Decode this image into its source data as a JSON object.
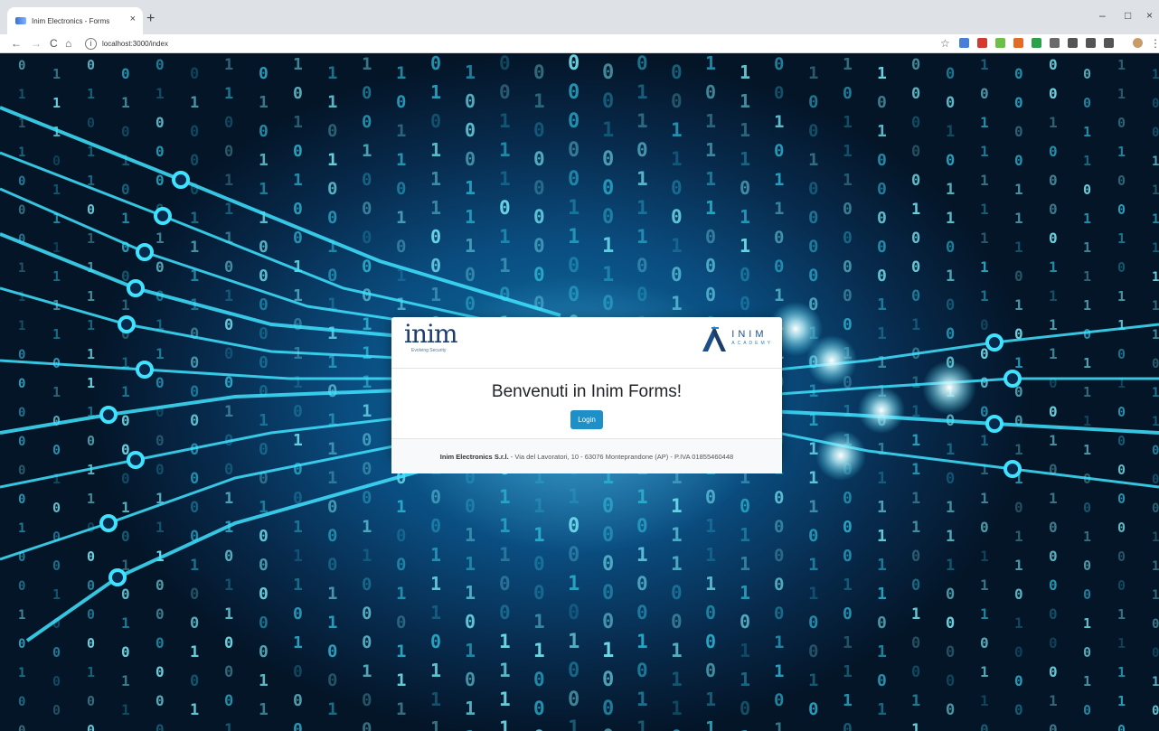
{
  "browser": {
    "tab_title": "Inim Electronics - Forms",
    "tab_close": "×",
    "new_tab": "+",
    "url": "localhost:3000/index",
    "minimize": "–",
    "maximize": "□",
    "close": "×"
  },
  "nav": {
    "back": "←",
    "forward": "→",
    "reload": "C",
    "home": "⌂",
    "info": "i",
    "star": "☆",
    "menu": "⋮"
  },
  "extensions": [
    "#4a7fd8",
    "#d33b32",
    "#6cc04a",
    "#e26b28",
    "#2ba14a",
    "#6b6b6b",
    "#555555",
    "#555555",
    "#555555",
    "#c99b66"
  ],
  "card": {
    "logo_left_word": "inim",
    "logo_left_tagline": "Evolving Security",
    "logo_right_name": "INIM",
    "logo_right_sub": "ACADEMY",
    "welcome": "Benvenuti in Inim Forms!",
    "login_label": "Login",
    "footer_company": "Inim Electronics S.r.l.",
    "footer_rest": " - Via del Lavoratori, 10 - 63076 Monteprandone (AP) - P.IVA 01855460448"
  },
  "colors": {
    "accent": "#1f8fc8",
    "brand_dark": "#1d3d6e",
    "background": "#0a4d80",
    "circuit": "#3fe3ff"
  }
}
